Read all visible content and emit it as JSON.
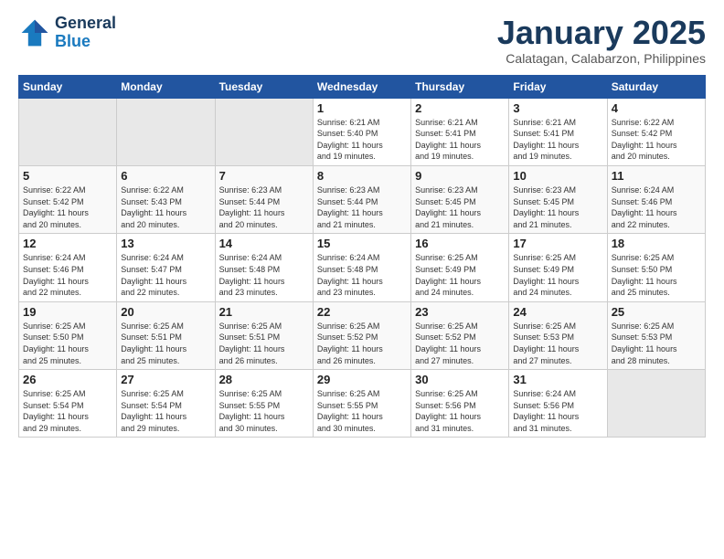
{
  "header": {
    "logo_line1": "General",
    "logo_line2": "Blue",
    "month_title": "January 2025",
    "location": "Calatagan, Calabarzon, Philippines"
  },
  "weekdays": [
    "Sunday",
    "Monday",
    "Tuesday",
    "Wednesday",
    "Thursday",
    "Friday",
    "Saturday"
  ],
  "weeks": [
    [
      {
        "day": "",
        "info": ""
      },
      {
        "day": "",
        "info": ""
      },
      {
        "day": "",
        "info": ""
      },
      {
        "day": "1",
        "info": "Sunrise: 6:21 AM\nSunset: 5:40 PM\nDaylight: 11 hours\nand 19 minutes."
      },
      {
        "day": "2",
        "info": "Sunrise: 6:21 AM\nSunset: 5:41 PM\nDaylight: 11 hours\nand 19 minutes."
      },
      {
        "day": "3",
        "info": "Sunrise: 6:21 AM\nSunset: 5:41 PM\nDaylight: 11 hours\nand 19 minutes."
      },
      {
        "day": "4",
        "info": "Sunrise: 6:22 AM\nSunset: 5:42 PM\nDaylight: 11 hours\nand 20 minutes."
      }
    ],
    [
      {
        "day": "5",
        "info": "Sunrise: 6:22 AM\nSunset: 5:42 PM\nDaylight: 11 hours\nand 20 minutes."
      },
      {
        "day": "6",
        "info": "Sunrise: 6:22 AM\nSunset: 5:43 PM\nDaylight: 11 hours\nand 20 minutes."
      },
      {
        "day": "7",
        "info": "Sunrise: 6:23 AM\nSunset: 5:44 PM\nDaylight: 11 hours\nand 20 minutes."
      },
      {
        "day": "8",
        "info": "Sunrise: 6:23 AM\nSunset: 5:44 PM\nDaylight: 11 hours\nand 21 minutes."
      },
      {
        "day": "9",
        "info": "Sunrise: 6:23 AM\nSunset: 5:45 PM\nDaylight: 11 hours\nand 21 minutes."
      },
      {
        "day": "10",
        "info": "Sunrise: 6:23 AM\nSunset: 5:45 PM\nDaylight: 11 hours\nand 21 minutes."
      },
      {
        "day": "11",
        "info": "Sunrise: 6:24 AM\nSunset: 5:46 PM\nDaylight: 11 hours\nand 22 minutes."
      }
    ],
    [
      {
        "day": "12",
        "info": "Sunrise: 6:24 AM\nSunset: 5:46 PM\nDaylight: 11 hours\nand 22 minutes."
      },
      {
        "day": "13",
        "info": "Sunrise: 6:24 AM\nSunset: 5:47 PM\nDaylight: 11 hours\nand 22 minutes."
      },
      {
        "day": "14",
        "info": "Sunrise: 6:24 AM\nSunset: 5:48 PM\nDaylight: 11 hours\nand 23 minutes."
      },
      {
        "day": "15",
        "info": "Sunrise: 6:24 AM\nSunset: 5:48 PM\nDaylight: 11 hours\nand 23 minutes."
      },
      {
        "day": "16",
        "info": "Sunrise: 6:25 AM\nSunset: 5:49 PM\nDaylight: 11 hours\nand 24 minutes."
      },
      {
        "day": "17",
        "info": "Sunrise: 6:25 AM\nSunset: 5:49 PM\nDaylight: 11 hours\nand 24 minutes."
      },
      {
        "day": "18",
        "info": "Sunrise: 6:25 AM\nSunset: 5:50 PM\nDaylight: 11 hours\nand 25 minutes."
      }
    ],
    [
      {
        "day": "19",
        "info": "Sunrise: 6:25 AM\nSunset: 5:50 PM\nDaylight: 11 hours\nand 25 minutes."
      },
      {
        "day": "20",
        "info": "Sunrise: 6:25 AM\nSunset: 5:51 PM\nDaylight: 11 hours\nand 25 minutes."
      },
      {
        "day": "21",
        "info": "Sunrise: 6:25 AM\nSunset: 5:51 PM\nDaylight: 11 hours\nand 26 minutes."
      },
      {
        "day": "22",
        "info": "Sunrise: 6:25 AM\nSunset: 5:52 PM\nDaylight: 11 hours\nand 26 minutes."
      },
      {
        "day": "23",
        "info": "Sunrise: 6:25 AM\nSunset: 5:52 PM\nDaylight: 11 hours\nand 27 minutes."
      },
      {
        "day": "24",
        "info": "Sunrise: 6:25 AM\nSunset: 5:53 PM\nDaylight: 11 hours\nand 27 minutes."
      },
      {
        "day": "25",
        "info": "Sunrise: 6:25 AM\nSunset: 5:53 PM\nDaylight: 11 hours\nand 28 minutes."
      }
    ],
    [
      {
        "day": "26",
        "info": "Sunrise: 6:25 AM\nSunset: 5:54 PM\nDaylight: 11 hours\nand 29 minutes."
      },
      {
        "day": "27",
        "info": "Sunrise: 6:25 AM\nSunset: 5:54 PM\nDaylight: 11 hours\nand 29 minutes."
      },
      {
        "day": "28",
        "info": "Sunrise: 6:25 AM\nSunset: 5:55 PM\nDaylight: 11 hours\nand 30 minutes."
      },
      {
        "day": "29",
        "info": "Sunrise: 6:25 AM\nSunset: 5:55 PM\nDaylight: 11 hours\nand 30 minutes."
      },
      {
        "day": "30",
        "info": "Sunrise: 6:25 AM\nSunset: 5:56 PM\nDaylight: 11 hours\nand 31 minutes."
      },
      {
        "day": "31",
        "info": "Sunrise: 6:24 AM\nSunset: 5:56 PM\nDaylight: 11 hours\nand 31 minutes."
      },
      {
        "day": "",
        "info": ""
      }
    ]
  ]
}
